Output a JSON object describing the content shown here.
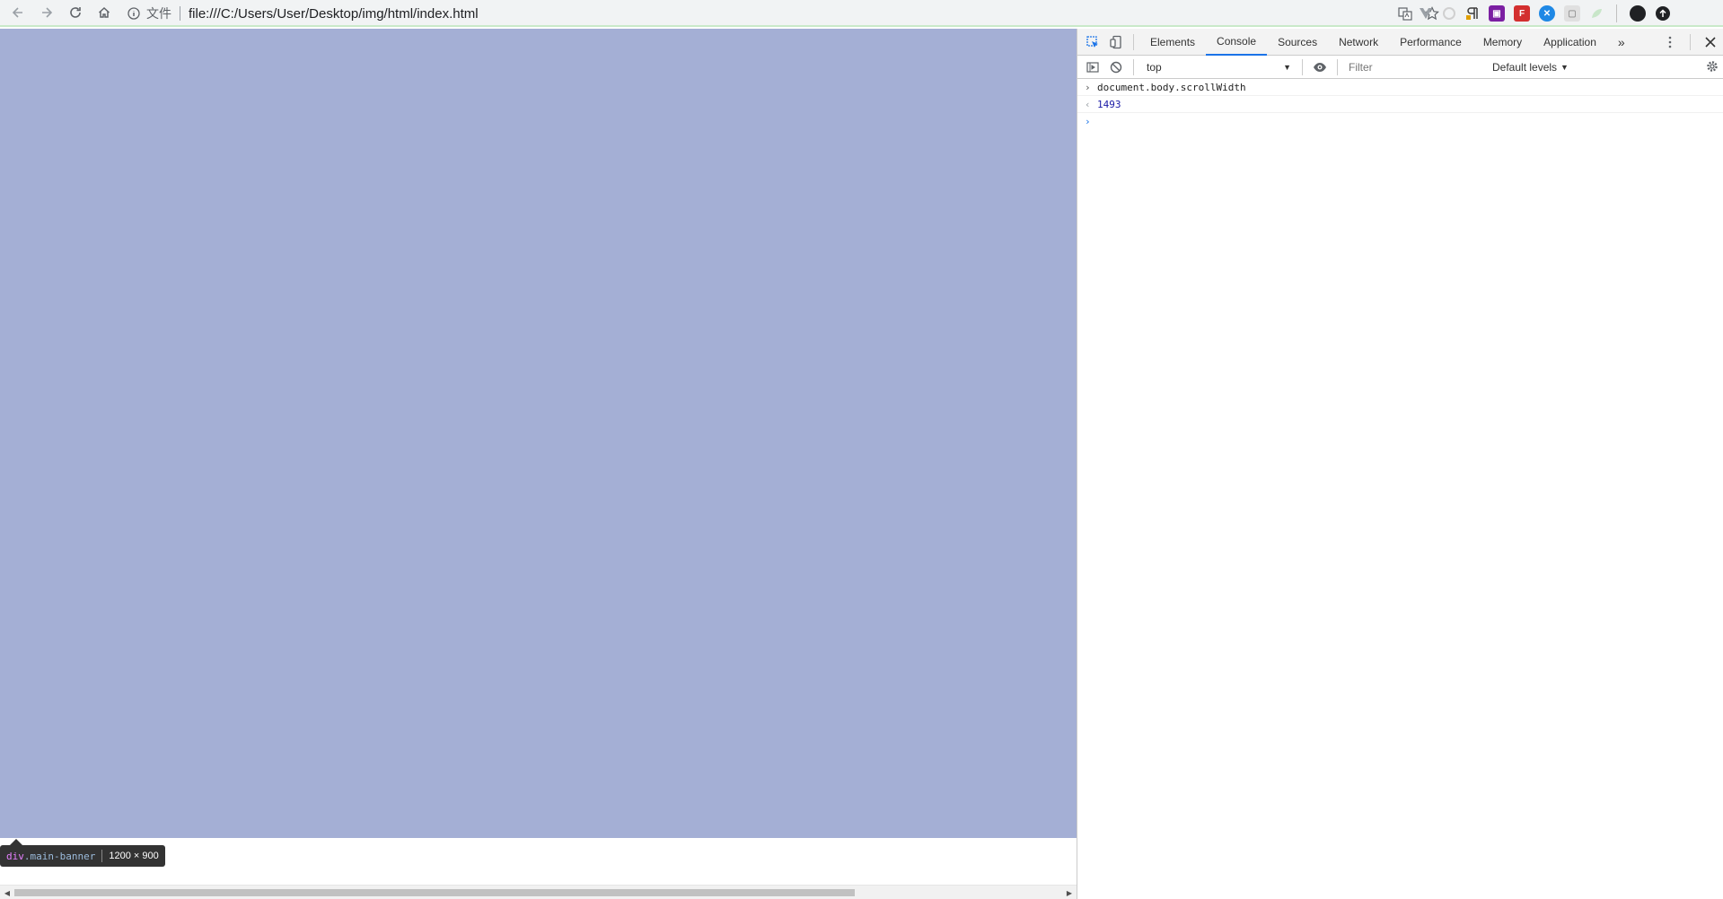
{
  "browser": {
    "file_chip": "文件",
    "url": "file:///C:/Users/User/Desktop/img/html/index.html"
  },
  "page": {
    "banner_color": "#a4afd5",
    "tooltip": {
      "tag": "div",
      "class": ".main-banner",
      "size": "1200 × 900"
    }
  },
  "devtools": {
    "tabs": [
      "Elements",
      "Console",
      "Sources",
      "Network",
      "Performance",
      "Memory",
      "Application"
    ],
    "active_tab": "Console",
    "context": "top",
    "filter_placeholder": "Filter",
    "levels": "Default levels",
    "console": {
      "command": "document.body.scrollWidth",
      "result": "1493"
    },
    "accent": "#1a73e8"
  }
}
